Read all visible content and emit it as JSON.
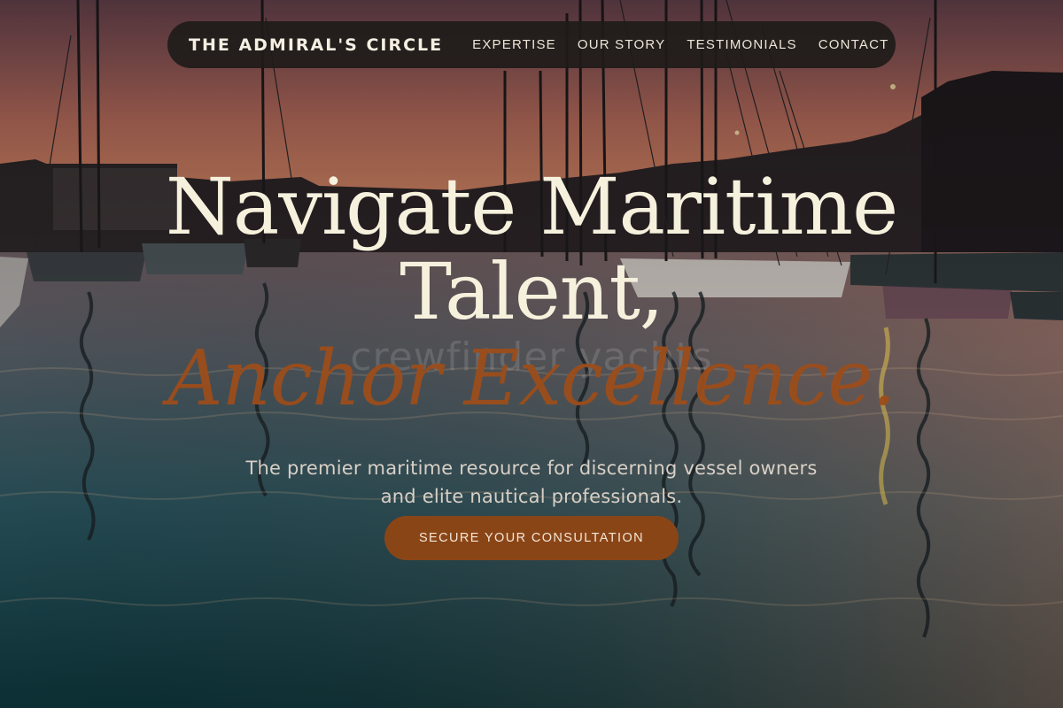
{
  "nav": {
    "brand": "THE ADMIRAL'S CIRCLE",
    "links": [
      "EXPERTISE",
      "OUR STORY",
      "TESTIMONIALS",
      "CONTACT"
    ]
  },
  "hero": {
    "headline_line1": "Navigate Maritime",
    "headline_line2": "Talent,",
    "headline_line3": "Anchor Excellence.",
    "watermark": "crewfinder yachts",
    "subtitle": "The premier maritime resource for discerning vessel owners and elite nautical professionals.",
    "cta_label": "SECURE YOUR CONSULTATION"
  },
  "colors": {
    "headline": "#f6f1dd",
    "accent": "#9c4d1b",
    "cta_background": "#8a4517",
    "nav_background": "#1e1b19"
  }
}
